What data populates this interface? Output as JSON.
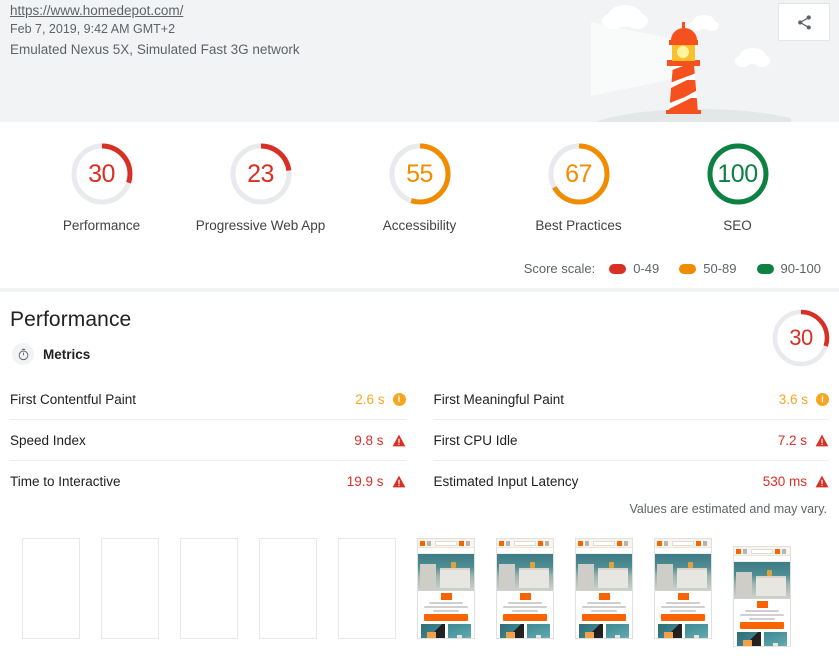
{
  "header": {
    "url": "https://www.homedepot.com/",
    "timestamp": "Feb 7, 2019, 9:42 AM GMT+2",
    "environment": "Emulated Nexus 5X, Simulated Fast 3G network",
    "share_icon": "share-icon",
    "illustration": "lighthouse-illustration"
  },
  "scores": {
    "categories": [
      {
        "label": "Performance",
        "value": "30",
        "color": "#d93025",
        "pct": 30
      },
      {
        "label": "Progressive Web App",
        "value": "23",
        "color": "#d93025",
        "pct": 23
      },
      {
        "label": "Accessibility",
        "value": "55",
        "color": "#f08c00",
        "pct": 55
      },
      {
        "label": "Best Practices",
        "value": "67",
        "color": "#f08c00",
        "pct": 67
      },
      {
        "label": "SEO",
        "value": "100",
        "color": "#0c8141",
        "pct": 100
      }
    ],
    "scale": {
      "label": "Score scale:",
      "items": [
        {
          "range": "0-49",
          "color": "#d93025"
        },
        {
          "range": "50-89",
          "color": "#f08c00"
        },
        {
          "range": "90-100",
          "color": "#0c8141"
        }
      ]
    }
  },
  "performance": {
    "title": "Performance",
    "score": "30",
    "score_color": "#d93025",
    "score_pct": 30,
    "metrics_heading": "Metrics",
    "metrics_icon": "stopwatch-icon",
    "estimate_note": "Values are estimated and may vary.",
    "metrics_left": [
      {
        "name": "First Contentful Paint",
        "value": "2.6 s",
        "status": "average",
        "icon": "info-circle-icon"
      },
      {
        "name": "Speed Index",
        "value": "9.8 s",
        "status": "fail",
        "icon": "warning-triangle-icon"
      },
      {
        "name": "Time to Interactive",
        "value": "19.9 s",
        "status": "fail",
        "icon": "warning-triangle-icon"
      }
    ],
    "metrics_right": [
      {
        "name": "First Meaningful Paint",
        "value": "3.6 s",
        "status": "average",
        "icon": "info-circle-icon"
      },
      {
        "name": "First CPU Idle",
        "value": "7.2 s",
        "status": "fail",
        "icon": "warning-triangle-icon"
      },
      {
        "name": "Estimated Input Latency",
        "value": "530 ms",
        "status": "fail",
        "icon": "warning-triangle-icon"
      }
    ]
  },
  "filmstrip": {
    "frames": [
      {
        "state": "blank"
      },
      {
        "state": "blank"
      },
      {
        "state": "blank"
      },
      {
        "state": "blank"
      },
      {
        "state": "blank"
      },
      {
        "state": "screenshot"
      },
      {
        "state": "screenshot"
      },
      {
        "state": "screenshot"
      },
      {
        "state": "screenshot"
      },
      {
        "state": "screenshot"
      }
    ]
  }
}
